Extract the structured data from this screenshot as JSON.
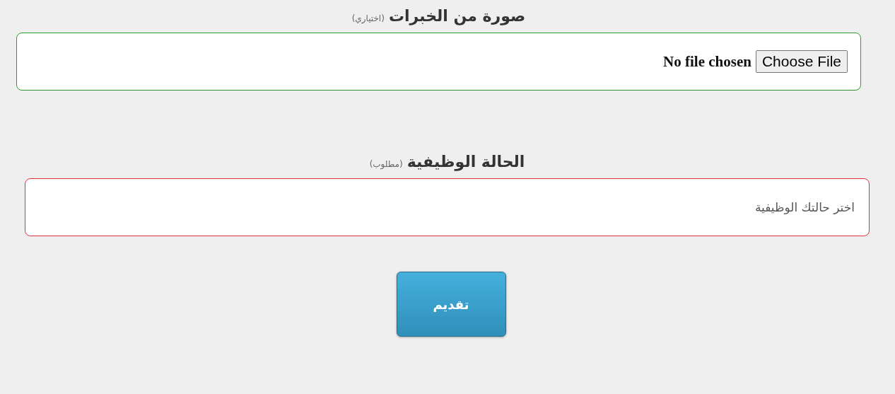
{
  "sections": [
    {
      "kind": "file",
      "label": "صورة من الخبرات",
      "note": "(اختياري)",
      "invalid": false,
      "file_status": "No file chosen",
      "button": "Choose File"
    },
    {
      "kind": "select",
      "label": "الحالة الوظيفية",
      "note": "(مطلوب)",
      "invalid": true,
      "placeholder": "اختر حالتك الوظيفية"
    }
  ],
  "submit": "تقديم"
}
